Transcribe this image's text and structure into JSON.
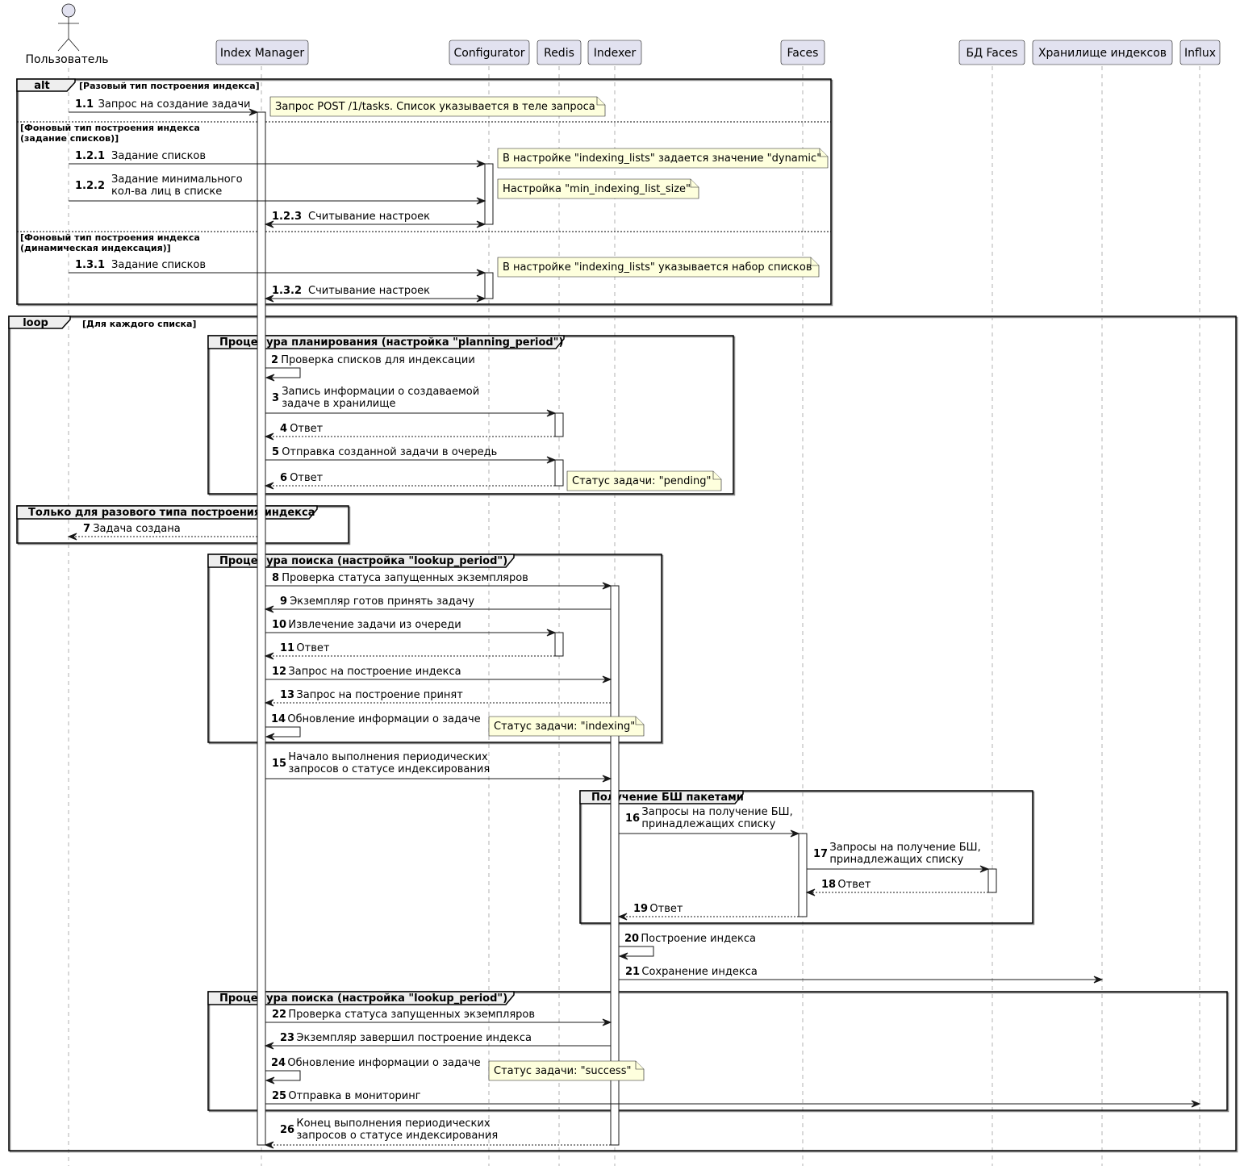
{
  "diagram_type": "sequence",
  "participants": [
    {
      "id": "user",
      "label": "Пользователь",
      "kind": "actor"
    },
    {
      "id": "im",
      "label": "Index Manager",
      "kind": "participant"
    },
    {
      "id": "cfg",
      "label": "Configurator",
      "kind": "participant"
    },
    {
      "id": "redis",
      "label": "Redis",
      "kind": "participant"
    },
    {
      "id": "idx",
      "label": "Indexer",
      "kind": "participant"
    },
    {
      "id": "faces",
      "label": "Faces",
      "kind": "participant"
    },
    {
      "id": "dbfaces",
      "label": "БД Faces",
      "kind": "participant"
    },
    {
      "id": "store",
      "label": "Хранилище индексов",
      "kind": "participant"
    },
    {
      "id": "influx",
      "label": "Influx",
      "kind": "participant"
    }
  ],
  "frames": [
    {
      "id": "alt",
      "keyword": "alt",
      "guards": [
        "[Разовый тип построения индекса]",
        "[Фоновый тип построения индекса\n(задание списков)]",
        "[Фоновый тип построения индекса\n(динамическая индексация)]"
      ]
    },
    {
      "id": "loop",
      "keyword": "loop",
      "guards": [
        "[Для каждого списка]"
      ]
    },
    {
      "id": "g-planning",
      "keyword": "Процедура планирования (настройка \"planning_period\")",
      "guards": []
    },
    {
      "id": "g-once",
      "keyword": "Только для разового типа построения индекса",
      "guards": []
    },
    {
      "id": "g-lookup1",
      "keyword": "Процедура поиска (настройка \"lookup_period\")",
      "guards": []
    },
    {
      "id": "g-batches",
      "keyword": "Получение БШ пакетами",
      "guards": []
    },
    {
      "id": "g-lookup2",
      "keyword": "Процедура поиска (настройка \"lookup_period\")",
      "guards": []
    }
  ],
  "messages": [
    {
      "num": "1.1",
      "from": "user",
      "to": "im",
      "text": "Запрос на создание задачи",
      "style": "solid"
    },
    {
      "num": "1.2.1",
      "from": "user",
      "to": "cfg",
      "text": "Задание списков",
      "style": "solid"
    },
    {
      "num": "1.2.2",
      "from": "user",
      "to": "cfg",
      "text": "Задание минимального\nкол-ва лиц в списке",
      "style": "solid"
    },
    {
      "num": "1.2.3",
      "from": "im",
      "to": "cfg",
      "text": "Считывание настроек",
      "style": "solid",
      "bidirectional": true
    },
    {
      "num": "1.3.1",
      "from": "user",
      "to": "cfg",
      "text": "Задание списков",
      "style": "solid"
    },
    {
      "num": "1.3.2",
      "from": "im",
      "to": "cfg",
      "text": "Считывание настроек",
      "style": "solid",
      "bidirectional": true
    },
    {
      "num": "2",
      "from": "im",
      "to": "im",
      "text": "Проверка списков для индексации",
      "style": "solid"
    },
    {
      "num": "3",
      "from": "im",
      "to": "redis",
      "text": "Запись информации о создаваемой\nзадаче в хранилище",
      "style": "solid"
    },
    {
      "num": "4",
      "from": "redis",
      "to": "im",
      "text": "Ответ",
      "style": "dashed"
    },
    {
      "num": "5",
      "from": "im",
      "to": "redis",
      "text": "Отправка созданной задачи в очередь",
      "style": "solid"
    },
    {
      "num": "6",
      "from": "redis",
      "to": "im",
      "text": "Ответ",
      "style": "dashed"
    },
    {
      "num": "7",
      "from": "im",
      "to": "user",
      "text": "Задача создана",
      "style": "dashed"
    },
    {
      "num": "8",
      "from": "im",
      "to": "idx",
      "text": "Проверка статуса запущенных экземпляров",
      "style": "solid"
    },
    {
      "num": "9",
      "from": "idx",
      "to": "im",
      "text": "Экземпляр готов принять задачу",
      "style": "solid"
    },
    {
      "num": "10",
      "from": "im",
      "to": "redis",
      "text": "Извлечение задачи из очереди",
      "style": "solid"
    },
    {
      "num": "11",
      "from": "redis",
      "to": "im",
      "text": "Ответ",
      "style": "dashed"
    },
    {
      "num": "12",
      "from": "im",
      "to": "idx",
      "text": "Запрос на построение индекса",
      "style": "solid"
    },
    {
      "num": "13",
      "from": "idx",
      "to": "im",
      "text": "Запрос на построение принят",
      "style": "dashed"
    },
    {
      "num": "14",
      "from": "im",
      "to": "im",
      "text": "Обновление информации о задаче",
      "style": "solid"
    },
    {
      "num": "15",
      "from": "im",
      "to": "idx",
      "text": "Начало выполнения периодических\nзапросов о статусе индексирования",
      "style": "solid"
    },
    {
      "num": "16",
      "from": "idx",
      "to": "faces",
      "text": "Запросы на получение БШ,\nпринадлежащих списку",
      "style": "solid"
    },
    {
      "num": "17",
      "from": "faces",
      "to": "dbfaces",
      "text": "Запросы на получение БШ,\nпринадлежащих списку",
      "style": "solid"
    },
    {
      "num": "18",
      "from": "dbfaces",
      "to": "faces",
      "text": "Ответ",
      "style": "dashed"
    },
    {
      "num": "19",
      "from": "faces",
      "to": "idx",
      "text": "Ответ",
      "style": "dashed"
    },
    {
      "num": "20",
      "from": "idx",
      "to": "idx",
      "text": "Построение индекса",
      "style": "solid"
    },
    {
      "num": "21",
      "from": "idx",
      "to": "store",
      "text": "Сохранение индекса",
      "style": "solid"
    },
    {
      "num": "22",
      "from": "im",
      "to": "idx",
      "text": "Проверка статуса запущенных экземпляров",
      "style": "solid"
    },
    {
      "num": "23",
      "from": "idx",
      "to": "im",
      "text": "Экземпляр завершил построение индекса",
      "style": "solid"
    },
    {
      "num": "24",
      "from": "im",
      "to": "im",
      "text": "Обновление информации о задаче",
      "style": "solid"
    },
    {
      "num": "25",
      "from": "im",
      "to": "influx",
      "text": "Отправка в мониторинг",
      "style": "solid"
    },
    {
      "num": "26",
      "from": "idx",
      "to": "im",
      "text": "Конец выполнения периодических\nзапросов о статусе индексирования",
      "style": "dashed"
    }
  ],
  "notes": [
    {
      "id": "n1",
      "attached_to": "1.1",
      "text": "Запрос POST /1/tasks. Список указывается в теле запроса"
    },
    {
      "id": "n2",
      "attached_to": "1.2.1",
      "text": "В настройке \"indexing_lists\" задается значение \"dynamic\""
    },
    {
      "id": "n3",
      "attached_to": "1.2.2",
      "text": "Настройка \"min_indexing_list_size\""
    },
    {
      "id": "n4",
      "attached_to": "1.3.1",
      "text": "В настройке \"indexing_lists\" указывается набор списков"
    },
    {
      "id": "n5",
      "attached_to": "6",
      "text": "Статус задачи: \"pending\""
    },
    {
      "id": "n6",
      "attached_to": "14",
      "text": "Статус задачи: \"indexing\""
    },
    {
      "id": "n7",
      "attached_to": "24",
      "text": "Статус задачи: \"success\""
    }
  ]
}
